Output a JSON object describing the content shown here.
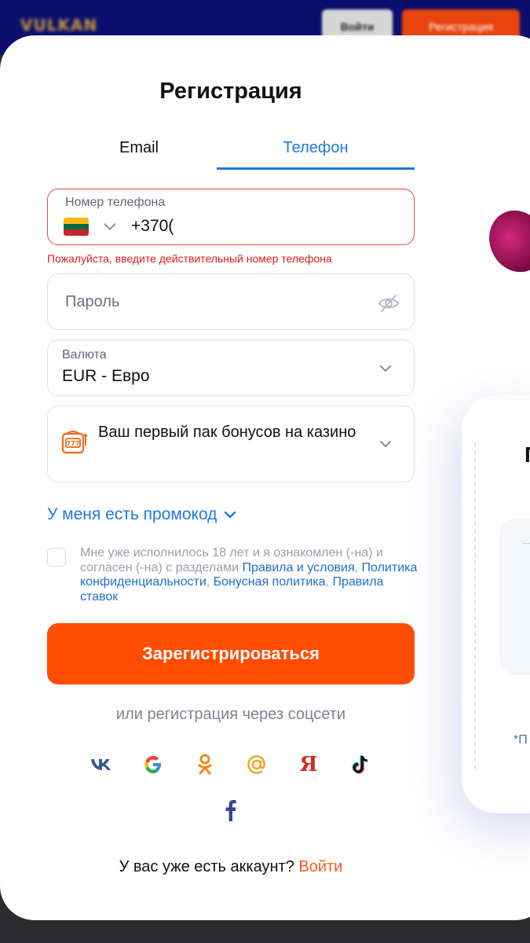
{
  "background": {
    "logo": "VULKAN",
    "login_button": "Войти",
    "register_button": "Регистрация"
  },
  "modal": {
    "title": "Регистрация",
    "tabs": [
      {
        "label": "Email",
        "active": false
      },
      {
        "label": "Телефон",
        "active": true
      }
    ],
    "phone": {
      "label": "Номер телефона",
      "country_flag": "lithuania-flag",
      "value": "+370(",
      "error": "Пожалуйста, введите действительный номер телефона"
    },
    "password": {
      "placeholder": "Пароль",
      "icon": "eye-off-icon"
    },
    "currency": {
      "label": "Валюта",
      "value": "EUR - Евро"
    },
    "bonus": {
      "icon": "slot-machine-icon",
      "text": "Ваш первый пак бонусов на казино"
    },
    "promo_link": "У меня есть промокод",
    "terms": {
      "prefix": "Мне уже исполнилось 18 лет и я ознакомлен (-на) и согласен (-на) с разделами ",
      "link_rules": "Правила и условия",
      "link_privacy": "Политика конфиденциальности",
      "link_bonus": "Бонусная политика",
      "link_bets": "Правила ставок"
    },
    "register_button": "Зарегистрироваться",
    "social_caption": "или регистрация через соцсети",
    "social": [
      "vk-icon",
      "google-icon",
      "odnoklassniki-icon",
      "mail-ru-icon",
      "yandex-icon",
      "tiktok-icon",
      "facebook-icon"
    ],
    "login_prompt": "У вас уже есть аккаунт?",
    "login_link": "Войти",
    "promo_side": {
      "heading_letter": "П",
      "footnote": "*П"
    }
  },
  "colors": {
    "accent": "#1e7ae0",
    "primary_button": "#ff4c00",
    "error": "#e01b1b",
    "header_bg": "#0a0f6e"
  }
}
